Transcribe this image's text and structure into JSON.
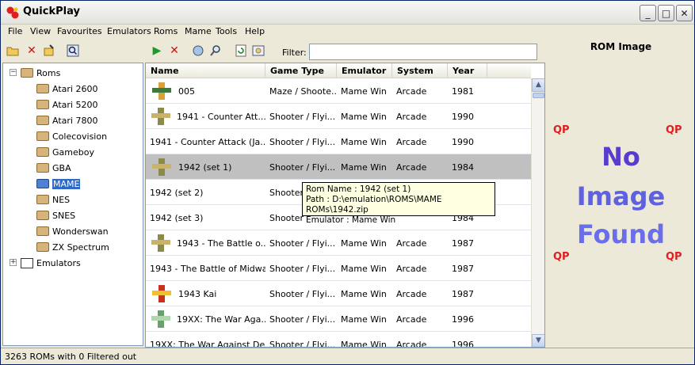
{
  "window": {
    "title": "QuickPlay",
    "min": "_",
    "max": "□",
    "close": "✕"
  },
  "menu": [
    "File",
    "View",
    "Favourites",
    "Emulators",
    "Roms",
    "Mame",
    "Tools",
    "Help"
  ],
  "tree": {
    "root": "Roms",
    "items": [
      "Atari 2600",
      "Atari 5200",
      "Atari 7800",
      "Colecovision",
      "Gameboy",
      "GBA",
      "MAME",
      "NES",
      "SNES",
      "Wonderswan",
      "ZX Spectrum"
    ],
    "selected": "MAME",
    "emulators": "Emulators"
  },
  "filter": {
    "label": "Filter:",
    "value": ""
  },
  "columns": [
    "Name",
    "Game Type",
    "Emulator",
    "System",
    "Year"
  ],
  "rows": [
    {
      "name": "005",
      "type": "Maze / Shoote...",
      "emulator": "Mame Win",
      "system": "Arcade",
      "year": "1981",
      "icon": "explorer-sprite-icon"
    },
    {
      "name": "1941 - Counter Att...",
      "type": "Shooter / Flyi...",
      "emulator": "Mame Win",
      "system": "Arcade",
      "year": "1990",
      "icon": "plane-sprite-icon"
    },
    {
      "name": "1941 - Counter Attack (Ja...",
      "type": "Shooter / Flyi...",
      "emulator": "Mame Win",
      "system": "Arcade",
      "year": "1990",
      "icon": ""
    },
    {
      "name": "1942 (set 1)",
      "type": "Shooter / Flyi...",
      "emulator": "Mame Win",
      "system": "Arcade",
      "year": "1984",
      "icon": "plane-sprite-icon"
    },
    {
      "name": "1942 (set 2)",
      "type": "Shooter",
      "emulator": "",
      "system": "",
      "year": "",
      "icon": ""
    },
    {
      "name": "1942 (set 3)",
      "type": "Shooter",
      "emulator": "",
      "system": "",
      "year": "1984",
      "icon": ""
    },
    {
      "name": "1943 - The Battle o...",
      "type": "Shooter / Flyi...",
      "emulator": "Mame Win",
      "system": "Arcade",
      "year": "1987",
      "icon": "plane-sprite-icon"
    },
    {
      "name": "1943 - The Battle of Midwa...",
      "type": "Shooter / Flyi...",
      "emulator": "Mame Win",
      "system": "Arcade",
      "year": "1987",
      "icon": ""
    },
    {
      "name": "1943 Kai",
      "type": "Shooter / Flyi...",
      "emulator": "Mame Win",
      "system": "Arcade",
      "year": "1987",
      "icon": "red-plane-sprite-icon"
    },
    {
      "name": "19XX: The War Aga...",
      "type": "Shooter / Flyi...",
      "emulator": "Mame Win",
      "system": "Arcade",
      "year": "1996",
      "icon": "green-plane-sprite-icon"
    },
    {
      "name": "19XX: The War Against De...",
      "type": "Shooter / Flyi...",
      "emulator": "Mame Win",
      "system": "Arcade",
      "year": "1996",
      "icon": ""
    }
  ],
  "tooltip": {
    "line1": "Rom Name : 1942 (set 1)",
    "line2": "Path : D:\\emulation\\ROMS\\MAME ROMs\\1942.zip",
    "line3": "Emulator : Mame Win"
  },
  "rom_panel": {
    "title": "ROM Image",
    "line1": "No",
    "line2": "Image",
    "line3": "Found",
    "logo": "QP"
  },
  "status": "3263 ROMs with 0 Filtered out"
}
